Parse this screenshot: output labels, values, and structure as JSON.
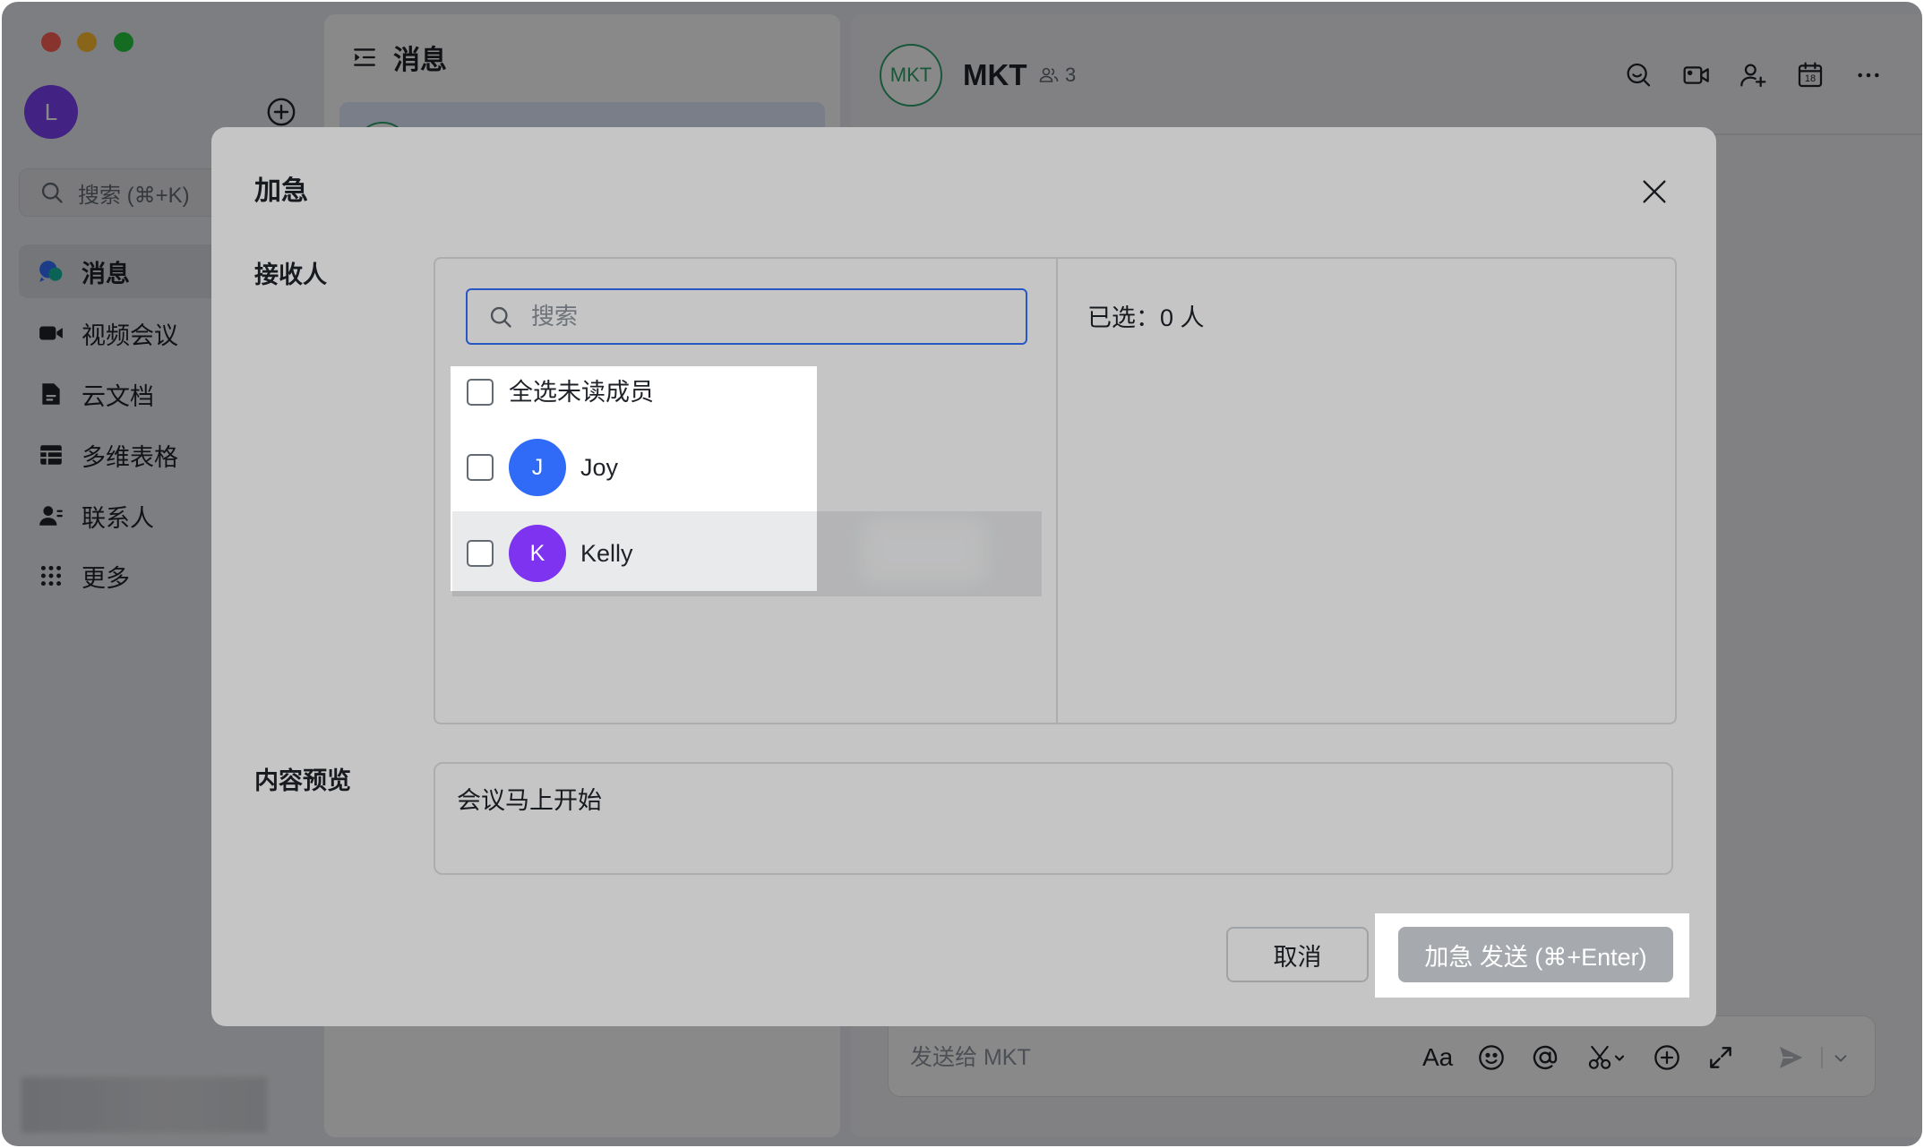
{
  "window": {
    "traffic_lights": [
      "#ff5f57",
      "#febc2e",
      "#28c840"
    ]
  },
  "sidebar": {
    "avatar_initial": "L",
    "avatar_color": "#7b3ff2",
    "search_placeholder": "搜索 (⌘+K)",
    "items": [
      {
        "label": "消息",
        "icon": "message-icon",
        "selected": true
      },
      {
        "label": "视频会议",
        "icon": "video-meeting-icon"
      },
      {
        "label": "云文档",
        "icon": "docs-icon"
      },
      {
        "label": "多维表格",
        "icon": "base-table-icon"
      },
      {
        "label": "联系人",
        "icon": "contacts-icon"
      },
      {
        "label": "更多",
        "icon": "more-apps-icon"
      }
    ]
  },
  "message_list": {
    "title": "消息",
    "icon": "collapse-list-icon"
  },
  "chat": {
    "avatar_text": "MKT",
    "avatar_color": "#2fa36b",
    "name": "MKT",
    "member_count": "3",
    "calendar_day": "18",
    "header_actions": [
      "chat-search-icon",
      "video-call-icon",
      "add-member-icon",
      "calendar-icon",
      "more-icon"
    ],
    "composer": {
      "placeholder": "发送给 MKT",
      "format_label": "Aa",
      "tools": [
        "emoji-icon",
        "at-icon",
        "screenshot-icon",
        "plus-icon",
        "expand-icon",
        "send-icon",
        "chevron-down-icon"
      ]
    }
  },
  "dialog": {
    "title": "加急",
    "recipients_label": "接收人",
    "search_placeholder": "搜索",
    "select_all_label": "全选未读成员",
    "members": [
      {
        "initial": "J",
        "name": "Joy",
        "color": "#2f6bf7"
      },
      {
        "initial": "K",
        "name": "Kelly",
        "color": "#7d33f0"
      }
    ],
    "selected_summary": "已选：0 人",
    "preview_label": "内容预览",
    "preview_text": "会议马上开始",
    "cancel_label": "取消",
    "send_label": "加急 发送 (⌘+Enter)"
  },
  "colors": {
    "accent": "#3370ff",
    "text": "#1f2329",
    "placeholder": "#8f959e",
    "send_disabled": "#a6a9ae"
  }
}
